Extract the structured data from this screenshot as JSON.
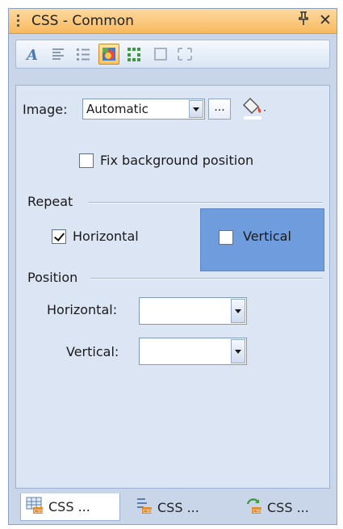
{
  "window": {
    "title": "CSS - Common",
    "pin_glyph": "q",
    "close_glyph": "✕"
  },
  "toolbar": {
    "buttons": [
      {
        "icon": "font-icon"
      },
      {
        "icon": "align-paragraph-icon"
      },
      {
        "icon": "list-icon"
      },
      {
        "icon": "background-image-icon",
        "selected": true
      },
      {
        "icon": "border-icon"
      },
      {
        "icon": "box-icon"
      },
      {
        "icon": "position-icon"
      }
    ]
  },
  "background": {
    "image_label": "Image:",
    "image_value": "Automatic",
    "browse_label": "...",
    "fix_position_label": "Fix background position",
    "fix_position_checked": false
  },
  "repeat": {
    "section_label": "Repeat",
    "horizontal_label": "Horizontal",
    "horizontal_checked": true,
    "vertical_label": "Vertical",
    "vertical_checked": false
  },
  "position": {
    "section_label": "Position",
    "horizontal_label": "Horizontal:",
    "horizontal_value": "",
    "vertical_label": "Vertical:",
    "vertical_value": ""
  },
  "tabs": [
    {
      "label": "CSS ...",
      "active": true
    },
    {
      "label": "CSS ...",
      "active": false
    },
    {
      "label": "CSS ...",
      "active": false
    }
  ],
  "colors": {
    "accent_title": "#f7b95e",
    "panel_bg": "#c9d6ea",
    "selected_box": "#6f9cdc"
  }
}
